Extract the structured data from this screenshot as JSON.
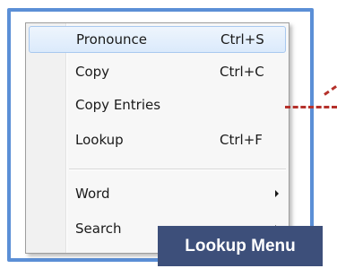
{
  "menu": {
    "items": [
      {
        "label": "Pronounce",
        "shortcut": "Ctrl+S",
        "highlighted": true,
        "submenu": false
      },
      {
        "label": "Copy",
        "shortcut": "Ctrl+C",
        "highlighted": false,
        "submenu": false
      },
      {
        "label": "Copy Entries",
        "shortcut": "",
        "highlighted": false,
        "submenu": false
      },
      {
        "label": "Lookup",
        "shortcut": "Ctrl+F",
        "highlighted": false,
        "submenu": false
      },
      {
        "label": "Word",
        "shortcut": "",
        "highlighted": false,
        "submenu": true
      },
      {
        "label": "Search",
        "shortcut": "",
        "highlighted": false,
        "submenu": true
      }
    ]
  },
  "caption": {
    "text": "Lookup Menu"
  },
  "colors": {
    "frame": "#5b8fd6",
    "caption_bg": "#3d4f7a",
    "leader": "#b5312b",
    "highlight_border": "#a8c8ef"
  }
}
